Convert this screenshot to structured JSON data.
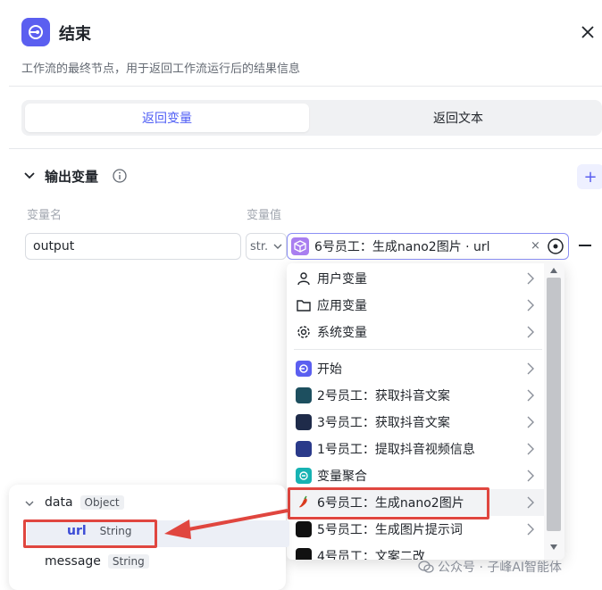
{
  "header": {
    "title": "结束",
    "description": "工作流的最终节点，用于返回工作流运行后的结果信息"
  },
  "tabs": [
    {
      "label": "返回变量",
      "active": true
    },
    {
      "label": "返回文本",
      "active": false
    }
  ],
  "section": {
    "title": "输出变量",
    "col_name": "变量名",
    "col_value": "变量值",
    "add_label": "+"
  },
  "row": {
    "name": "output",
    "type": "str.",
    "value": "6号员工：生成nano2图片 · url",
    "clear": "×"
  },
  "dropdown": {
    "groups": [
      {
        "label": "用户变量",
        "icon": "user-icon"
      },
      {
        "label": "应用变量",
        "icon": "folder-icon"
      },
      {
        "label": "系统变量",
        "icon": "gear-icon"
      }
    ],
    "nodes": [
      {
        "label": "开始",
        "icon": "start-node-icon",
        "color": "#5b5ff0"
      },
      {
        "label": "2号员工：获取抖音文案",
        "icon": "avatar-2-icon",
        "color": "#1d4f5f"
      },
      {
        "label": "3号员工：获取抖音文案",
        "icon": "avatar-3-icon",
        "color": "#1f2b4a"
      },
      {
        "label": "1号员工：提取抖音视频信息",
        "icon": "avatar-1-icon",
        "color": "#2a3a8a"
      },
      {
        "label": "变量聚合",
        "icon": "aggregate-icon",
        "color": "#17b3b3"
      },
      {
        "label": "6号员工：生成nano2图片",
        "icon": "chili-icon",
        "color": "#d93a1e",
        "selected": true
      },
      {
        "label": "5号员工：生成图片提示词",
        "icon": "avatar-5-icon",
        "color": "#111111"
      },
      {
        "label": "4号员工：文案二改",
        "icon": "avatar-4-icon",
        "color": "#111111"
      }
    ]
  },
  "data_panel": {
    "root": {
      "name": "data",
      "type": "Object"
    },
    "children": [
      {
        "name": "url",
        "type": "String",
        "highlighted": true
      },
      {
        "name": "message",
        "type": "String"
      }
    ]
  },
  "watermark": "公众号 · 子峰AI智能体",
  "colors": {
    "accent": "#5b5ff0",
    "highlight": "#e0463f"
  }
}
